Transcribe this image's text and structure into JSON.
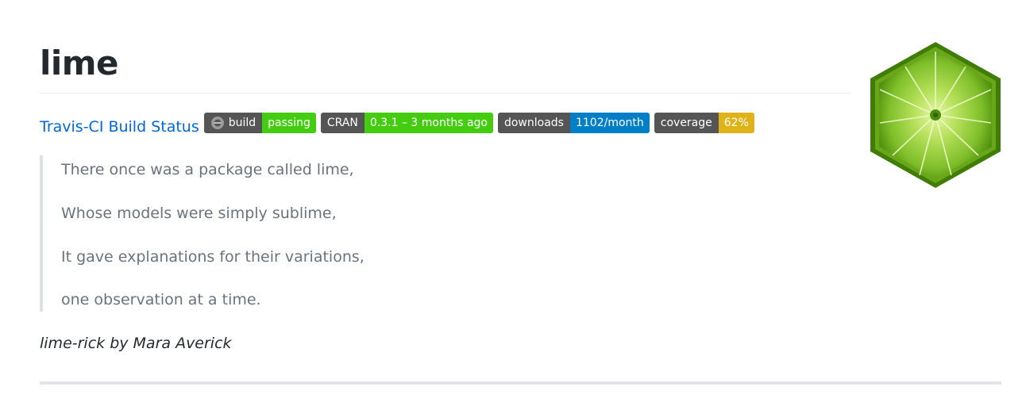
{
  "title": "lime",
  "travis_link": "Travis-CI Build Status",
  "badges": [
    {
      "label": "build",
      "value": "passing",
      "color": "#4c1"
    },
    {
      "label": "CRAN",
      "value": "0.3.1 – 3 months ago",
      "color": "#4c1"
    },
    {
      "label": "downloads",
      "value": "1102/month",
      "color": "#007ec6"
    },
    {
      "label": "coverage",
      "value": "62%",
      "color": "#dfb317"
    }
  ],
  "badge_icons": {
    "build": "travis-ci-icon"
  },
  "poem": {
    "lines": [
      "There once was a package called lime,",
      "Whose models were simply sublime,",
      "It gave explanations for their variations,",
      "one observation at a time."
    ]
  },
  "credit": "lime-rick by Mara Averick",
  "logo": {
    "icon": "lime-hexagon-logo",
    "colors": {
      "rind": "#3f7d06",
      "flesh": "#8cc63f",
      "center": "#d7f08a"
    }
  }
}
